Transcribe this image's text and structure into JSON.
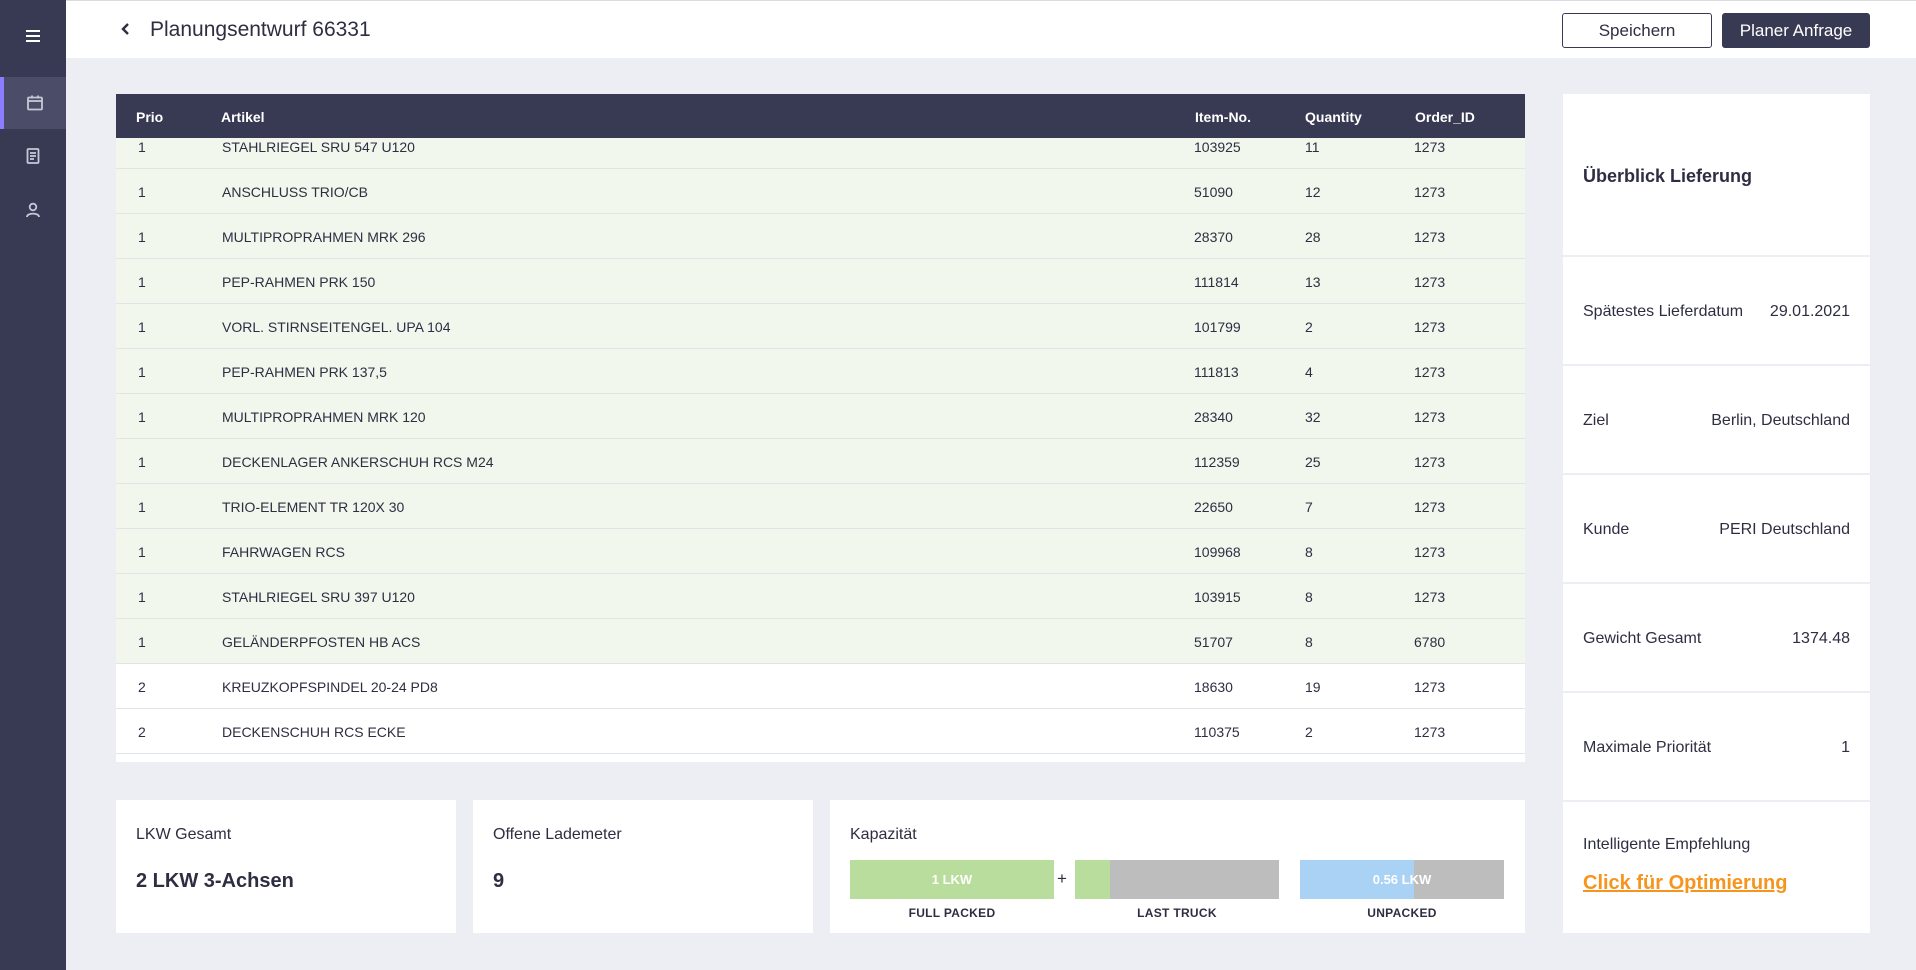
{
  "sidebar": {
    "items": [
      {
        "icon": "menu-icon"
      },
      {
        "icon": "calendar-icon",
        "active": true
      },
      {
        "icon": "document-icon"
      },
      {
        "icon": "user-icon"
      }
    ]
  },
  "header": {
    "title": "Planungsentwurf 66331",
    "save_label": "Speichern",
    "request_label": "Planer Anfrage"
  },
  "table": {
    "columns": [
      "Prio",
      "Artikel",
      "Item-No.",
      "Quantity",
      "Order_ID"
    ],
    "rows": [
      {
        "prio": "1",
        "artikel": "STAHLRIEGEL SRU 547 U120",
        "item": "103925",
        "qty": "11",
        "order": "1273"
      },
      {
        "prio": "1",
        "artikel": "ANSCHLUSS TRIO/CB",
        "item": "51090",
        "qty": "12",
        "order": "1273"
      },
      {
        "prio": "1",
        "artikel": "MULTIPROPRAHMEN MRK 296",
        "item": "28370",
        "qty": "28",
        "order": "1273"
      },
      {
        "prio": "1",
        "artikel": "PEP-RAHMEN PRK 150",
        "item": "111814",
        "qty": "13",
        "order": "1273"
      },
      {
        "prio": "1",
        "artikel": "VORL. STIRNSEITENGEL. UPA 104",
        "item": "101799",
        "qty": "2",
        "order": "1273"
      },
      {
        "prio": "1",
        "artikel": "PEP-RAHMEN PRK 137,5",
        "item": "111813",
        "qty": "4",
        "order": "1273"
      },
      {
        "prio": "1",
        "artikel": "MULTIPROPRAHMEN MRK 120",
        "item": "28340",
        "qty": "32",
        "order": "1273"
      },
      {
        "prio": "1",
        "artikel": "DECKENLAGER ANKERSCHUH RCS M24",
        "item": "112359",
        "qty": "25",
        "order": "1273"
      },
      {
        "prio": "1",
        "artikel": "TRIO-ELEMENT TR 120X 30",
        "item": "22650",
        "qty": "7",
        "order": "1273"
      },
      {
        "prio": "1",
        "artikel": "FAHRWAGEN RCS",
        "item": "109968",
        "qty": "8",
        "order": "1273"
      },
      {
        "prio": "1",
        "artikel": "STAHLRIEGEL SRU 397 U120",
        "item": "103915",
        "qty": "8",
        "order": "1273"
      },
      {
        "prio": "1",
        "artikel": "GELÄNDERPFOSTEN HB ACS",
        "item": "51707",
        "qty": "8",
        "order": "6780"
      },
      {
        "prio": "2",
        "artikel": "KREUZKOPFSPINDEL 20-24 PD8",
        "item": "18630",
        "qty": "19",
        "order": "1273"
      },
      {
        "prio": "2",
        "artikel": "DECKENSCHUH RCS ECKE",
        "item": "110375",
        "qty": "2",
        "order": "1273"
      }
    ]
  },
  "overview": {
    "title": "Überblick Lieferung",
    "rows": [
      {
        "label": "Spätestes Lieferdatum",
        "value": "29.01.2021"
      },
      {
        "label": "Ziel",
        "value": "Berlin, Deutschland"
      },
      {
        "label": "Kunde",
        "value": "PERI Deutschland"
      },
      {
        "label": "Gewicht Gesamt",
        "value": "1374.48"
      },
      {
        "label": "Maximale Priorität",
        "value": "1"
      }
    ],
    "recommendation_label": "Intelligente Empfehlung",
    "recommendation_link": "Click für Optimierung"
  },
  "stats": {
    "lkw_label": "LKW Gesamt",
    "lkw_value": "2 LKW 3-Achsen",
    "lademeter_label": "Offene Lademeter",
    "lademeter_value": "9"
  },
  "capacity": {
    "label": "Kapazität",
    "plus": "+",
    "bars": [
      {
        "text": "1 LKW",
        "caption": "FULL PACKED",
        "fill": 1.0,
        "color": "#b9dd9c"
      },
      {
        "text": "",
        "caption": "LAST TRUCK",
        "fill": 0.17,
        "color": "#b9dd9c"
      },
      {
        "text": "0.56 LKW",
        "caption": "UNPACKED",
        "fill": 0.56,
        "color": "#a9d2f5"
      }
    ]
  },
  "colors": {
    "sidebar": "#383a53",
    "accent": "#8b7dff",
    "prio1_row": "#f1f7ec",
    "link": "#f7941d"
  }
}
